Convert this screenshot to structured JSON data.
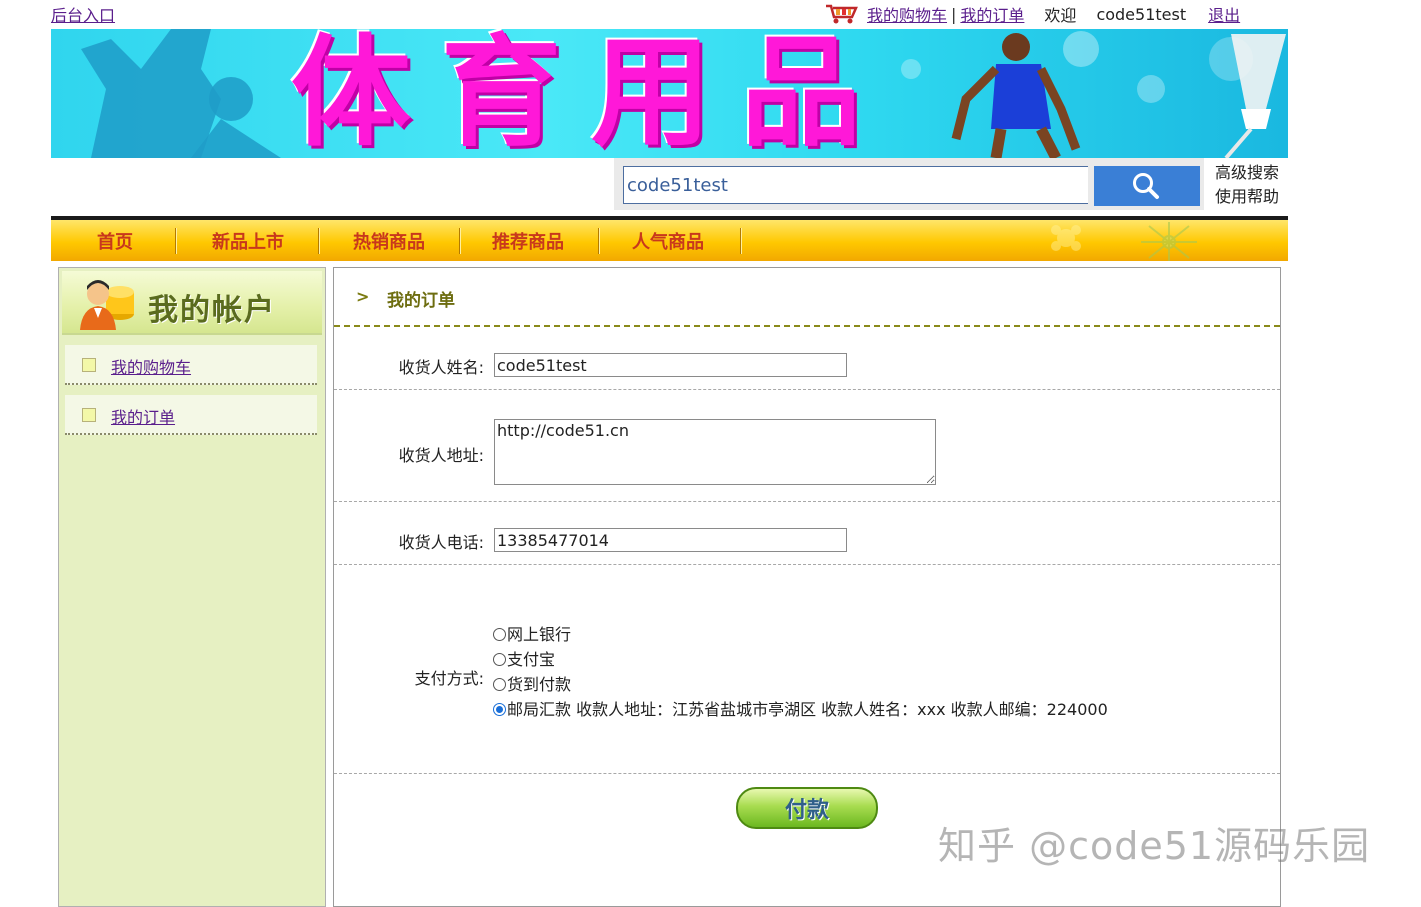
{
  "topbar": {
    "admin_link": "后台入口",
    "cart_link": "我的购物车",
    "separator": "|",
    "orders_link": "我的订单",
    "welcome": "欢迎",
    "username": "code51test",
    "logout": "退出"
  },
  "banner": {
    "title": "体育用品"
  },
  "search": {
    "value": "code51test",
    "advanced": "高级搜索",
    "help": "使用帮助"
  },
  "nav": {
    "items": [
      "首页",
      "新品上市",
      "热销商品",
      "推荐商品",
      "人气商品"
    ]
  },
  "sidebar": {
    "title": "我的帐户",
    "items": [
      "我的购物车",
      "我的订单"
    ]
  },
  "main": {
    "breadcrumb_arrow": ">",
    "title": "我的订单",
    "form": {
      "name_label": "收货人姓名:",
      "name_value": "code51test",
      "address_label": "收货人地址:",
      "address_value": "http://code51.cn",
      "phone_label": "收货人电话:",
      "phone_value": "13385477014",
      "payment_label": "支付方式:",
      "payment_options": [
        {
          "label": "网上银行",
          "checked": false
        },
        {
          "label": "支付宝",
          "checked": false
        },
        {
          "label": "货到付款",
          "checked": false
        },
        {
          "label": "邮局汇款 收款人地址：江苏省盐城市亭湖区 收款人姓名：xxx 收款人邮编：224000",
          "checked": true
        }
      ],
      "pay_button": "付款"
    }
  },
  "watermark": "知乎 @code51源码乐园",
  "colors": {
    "link": "#5a1e8c",
    "banner_text": "#ff18d8",
    "nav_text": "#c8381c",
    "sidebar_bg": "#e6f0c2",
    "search_button": "#3a7fd6"
  }
}
